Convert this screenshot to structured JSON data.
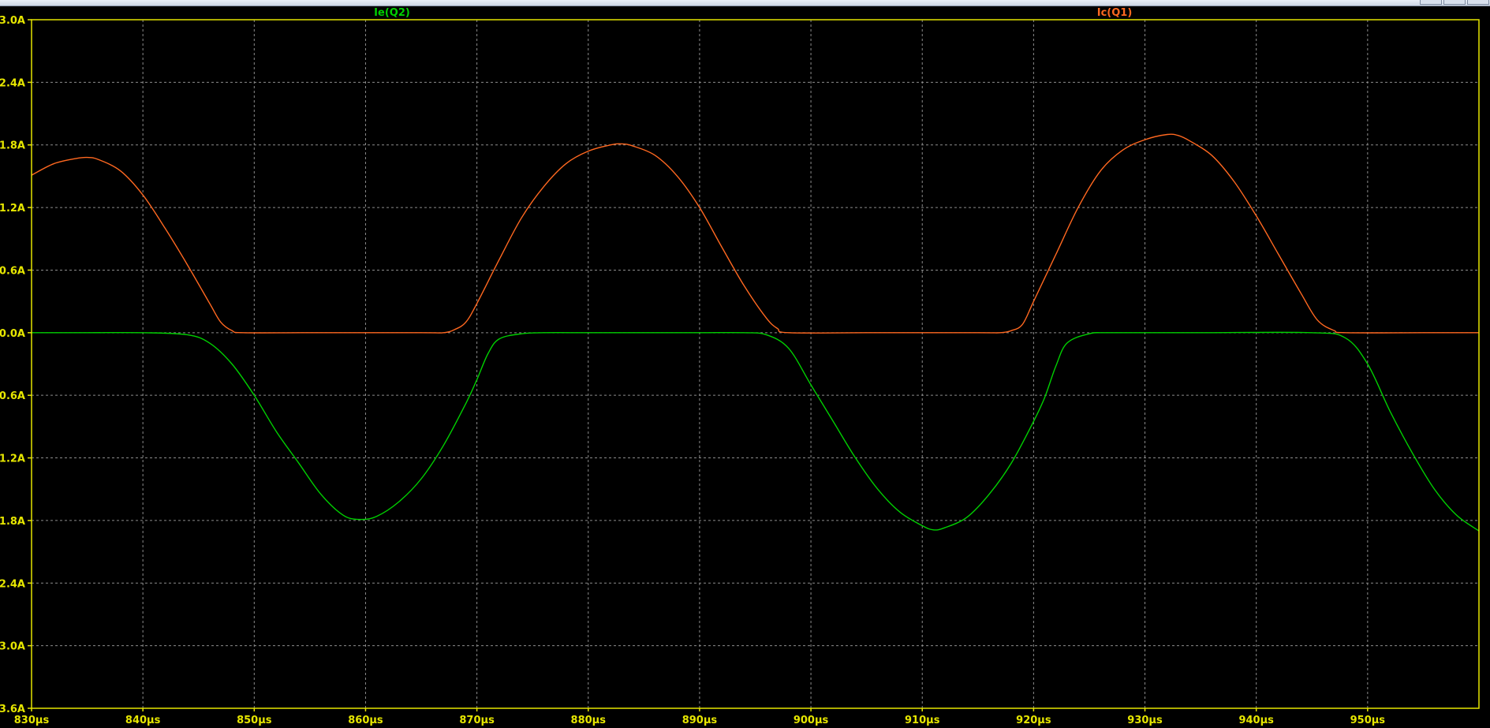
{
  "window": {
    "title_fragment": "..."
  },
  "colors": {
    "background": "#000000",
    "axis": "#e6e600",
    "grid": "#8c8c8c",
    "tick_label": "#e6e600"
  },
  "chart_data": {
    "type": "line",
    "title": "",
    "xlabel": "",
    "ylabel": "",
    "x_unit": "µs",
    "y_unit": "A",
    "xlim": [
      830,
      960
    ],
    "ylim": [
      -3.6,
      3.0
    ],
    "x_ticks": [
      830,
      840,
      850,
      860,
      870,
      880,
      890,
      900,
      910,
      920,
      930,
      940,
      950
    ],
    "x_tick_labels": [
      "830µs",
      "840µs",
      "850µs",
      "860µs",
      "870µs",
      "880µs",
      "890µs",
      "900µs",
      "910µs",
      "920µs",
      "930µs",
      "940µs",
      "950µs"
    ],
    "y_ticks": [
      3.0,
      2.4,
      1.8,
      1.2,
      0.6,
      0.0,
      -0.6,
      -1.2,
      -1.8,
      -2.4,
      -3.0,
      -3.6
    ],
    "y_tick_labels": [
      "3.0A",
      "2.4A",
      "1.8A",
      "1.2A",
      "0.6A",
      "0.0A",
      "-0.6A",
      "-1.2A",
      "-1.8A",
      "-2.4A",
      "-3.0A",
      "-3.6A"
    ],
    "grid": true,
    "legend_placement": "top",
    "series": [
      {
        "name": "Ie(Q2)",
        "color": "#00d000",
        "points": [
          [
            830,
            0.0
          ],
          [
            835,
            0.0
          ],
          [
            840,
            0.0
          ],
          [
            844,
            -0.02
          ],
          [
            846,
            -0.1
          ],
          [
            848,
            -0.3
          ],
          [
            850,
            -0.6
          ],
          [
            852,
            -0.95
          ],
          [
            854,
            -1.25
          ],
          [
            856,
            -1.55
          ],
          [
            858,
            -1.75
          ],
          [
            859.5,
            -1.79
          ],
          [
            861,
            -1.76
          ],
          [
            863,
            -1.62
          ],
          [
            865,
            -1.4
          ],
          [
            867,
            -1.08
          ],
          [
            869,
            -0.68
          ],
          [
            870,
            -0.45
          ],
          [
            871,
            -0.2
          ],
          [
            872,
            -0.06
          ],
          [
            874,
            -0.01
          ],
          [
            876,
            0.0
          ],
          [
            880,
            0.0
          ],
          [
            885,
            0.0
          ],
          [
            890,
            0.0
          ],
          [
            894,
            0.0
          ],
          [
            896,
            -0.02
          ],
          [
            898,
            -0.15
          ],
          [
            900,
            -0.5
          ],
          [
            902,
            -0.85
          ],
          [
            904,
            -1.2
          ],
          [
            906,
            -1.5
          ],
          [
            908,
            -1.72
          ],
          [
            910,
            -1.85
          ],
          [
            911,
            -1.89
          ],
          [
            912,
            -1.87
          ],
          [
            914,
            -1.77
          ],
          [
            916,
            -1.55
          ],
          [
            918,
            -1.25
          ],
          [
            920,
            -0.85
          ],
          [
            921,
            -0.62
          ],
          [
            922,
            -0.32
          ],
          [
            923,
            -0.1
          ],
          [
            925,
            -0.01
          ],
          [
            927,
            0.0
          ],
          [
            935,
            0.0
          ],
          [
            945,
            0.0
          ],
          [
            948,
            -0.05
          ],
          [
            950,
            -0.3
          ],
          [
            952,
            -0.75
          ],
          [
            954,
            -1.15
          ],
          [
            956,
            -1.5
          ],
          [
            958,
            -1.75
          ],
          [
            960,
            -1.9
          ]
        ]
      },
      {
        "name": "Ic(Q1)",
        "color": "#ff6820",
        "points": [
          [
            830,
            1.51
          ],
          [
            832,
            1.62
          ],
          [
            834,
            1.67
          ],
          [
            835,
            1.68
          ],
          [
            836,
            1.66
          ],
          [
            838,
            1.55
          ],
          [
            840,
            1.32
          ],
          [
            842,
            1.0
          ],
          [
            844,
            0.65
          ],
          [
            846,
            0.28
          ],
          [
            847,
            0.1
          ],
          [
            848,
            0.02
          ],
          [
            849,
            0.0
          ],
          [
            855,
            0.0
          ],
          [
            865,
            0.0
          ],
          [
            867,
            0.0
          ],
          [
            868,
            0.03
          ],
          [
            869,
            0.1
          ],
          [
            870,
            0.28
          ],
          [
            872,
            0.7
          ],
          [
            874,
            1.1
          ],
          [
            876,
            1.4
          ],
          [
            878,
            1.62
          ],
          [
            880,
            1.74
          ],
          [
            882,
            1.8
          ],
          [
            883,
            1.81
          ],
          [
            884,
            1.79
          ],
          [
            886,
            1.7
          ],
          [
            888,
            1.5
          ],
          [
            890,
            1.2
          ],
          [
            892,
            0.82
          ],
          [
            894,
            0.45
          ],
          [
            896,
            0.14
          ],
          [
            897,
            0.04
          ],
          [
            898,
            0.0
          ],
          [
            905,
            0.0
          ],
          [
            915,
            0.0
          ],
          [
            917,
            0.0
          ],
          [
            918,
            0.02
          ],
          [
            919,
            0.08
          ],
          [
            920,
            0.3
          ],
          [
            922,
            0.75
          ],
          [
            924,
            1.2
          ],
          [
            926,
            1.55
          ],
          [
            928,
            1.75
          ],
          [
            930,
            1.85
          ],
          [
            932,
            1.9
          ],
          [
            933,
            1.89
          ],
          [
            934,
            1.84
          ],
          [
            936,
            1.7
          ],
          [
            938,
            1.45
          ],
          [
            940,
            1.12
          ],
          [
            942,
            0.75
          ],
          [
            944,
            0.38
          ],
          [
            945.5,
            0.12
          ],
          [
            947,
            0.02
          ],
          [
            948,
            0.0
          ],
          [
            955,
            0.0
          ],
          [
            960,
            0.0
          ]
        ]
      }
    ]
  }
}
